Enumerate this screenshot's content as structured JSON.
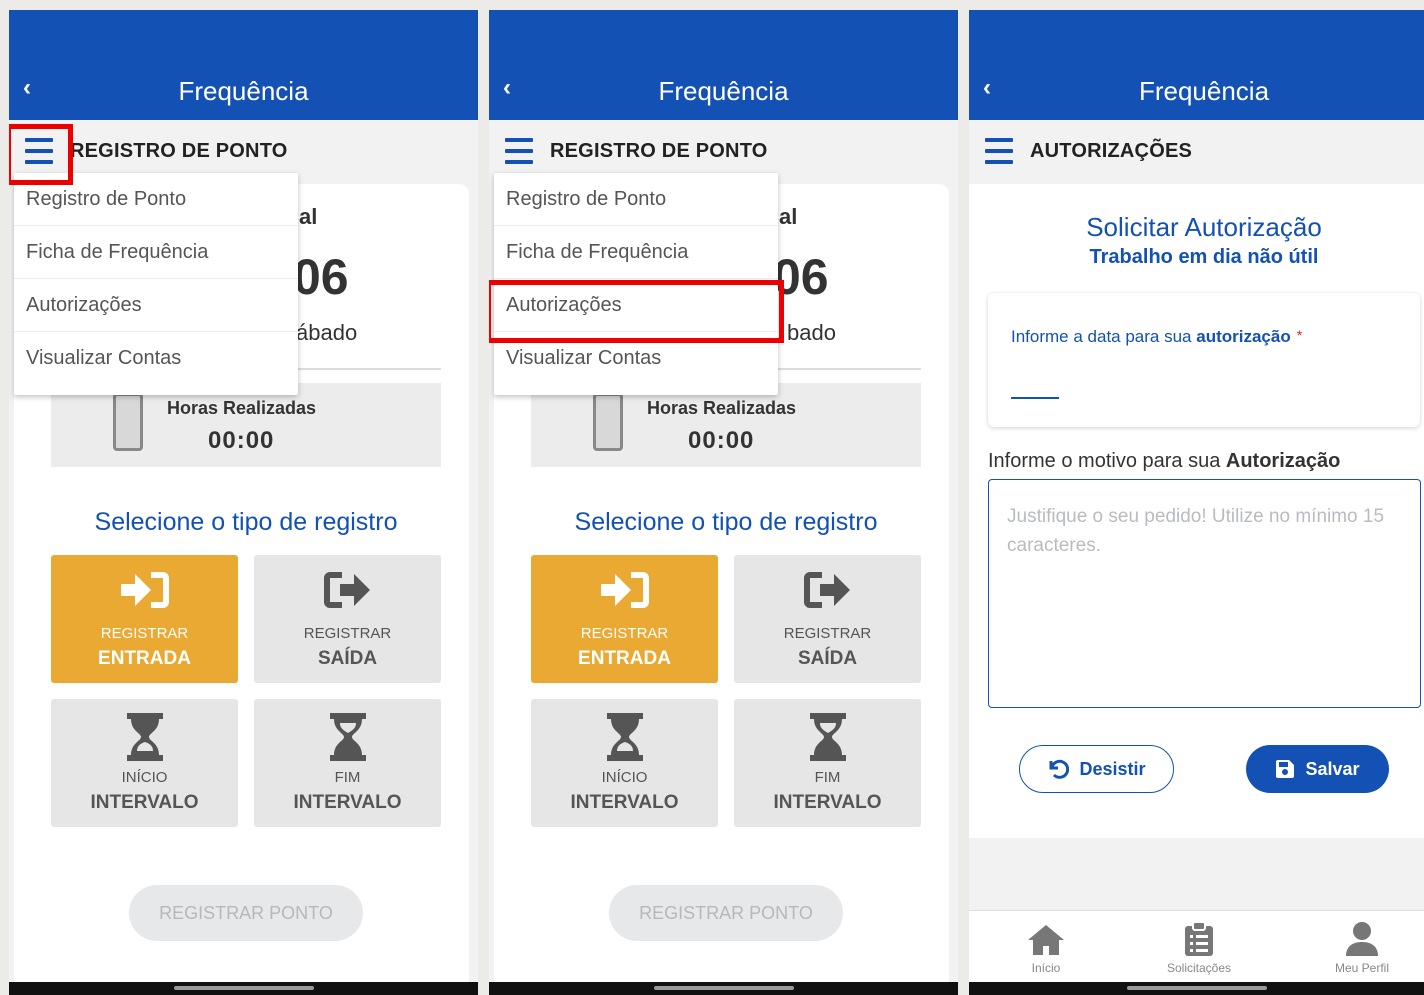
{
  "app": {
    "title": "Frequência",
    "back_glyph": "‹",
    "header_color": "#1351b4",
    "accent_color": "#e9a933"
  },
  "registro": {
    "section_title": "REGISTRO DE PONTO",
    "partial_text_1": "al",
    "partial_text_2": "06",
    "partial_text_3": "ábado",
    "partial_text_3_p2": "bado",
    "hours_label": "Horas Realizadas",
    "hours_value": "00:00",
    "select_title": "Selecione o tipo de registro",
    "buttons": [
      {
        "line1": "REGISTRAR",
        "line2": "ENTRADA",
        "icon": "sign-in-icon"
      },
      {
        "line1": "REGISTRAR",
        "line2": "SAÍDA",
        "icon": "sign-out-icon"
      },
      {
        "line1": "INÍCIO",
        "line2": "INTERVALO",
        "icon": "hourglass-start-icon"
      },
      {
        "line1": "FIM",
        "line2": "INTERVALO",
        "icon": "hourglass-end-icon"
      }
    ],
    "submit_label": "REGISTRAR PONTO"
  },
  "menu": {
    "items": [
      "Registro de Ponto",
      "Ficha de Frequência",
      "Autorizações",
      "Visualizar Contas"
    ]
  },
  "autorizacoes": {
    "section_title": "AUTORIZAÇÕES",
    "title": "Solicitar Autorização",
    "subtitle": "Trabalho em dia não útil",
    "date_label_prefix": "Informe a data para sua ",
    "date_label_bold": "autorização",
    "required_mark": "*",
    "reason_label_prefix": "Informe o motivo para sua ",
    "reason_label_bold": "Autorização",
    "reason_placeholder": "Justifique o seu pedido! Utilize no mínimo 15 caracteres.",
    "cancel_label": "Desistir",
    "save_label": "Salvar"
  },
  "bottom_nav": {
    "items": [
      {
        "label": "Início",
        "icon": "home-icon"
      },
      {
        "label": "Solicitações",
        "icon": "clipboard-list-icon"
      },
      {
        "label": "Meu Perfil",
        "icon": "user-icon"
      }
    ]
  }
}
